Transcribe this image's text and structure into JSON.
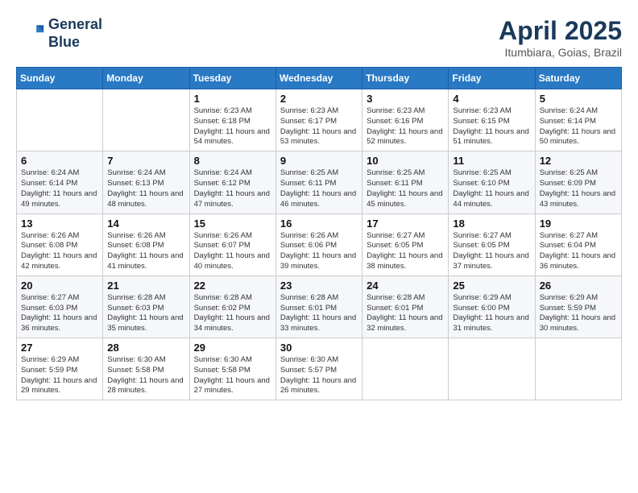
{
  "header": {
    "logo_line1": "General",
    "logo_line2": "Blue",
    "month": "April 2025",
    "location": "Itumbiara, Goias, Brazil"
  },
  "weekdays": [
    "Sunday",
    "Monday",
    "Tuesday",
    "Wednesday",
    "Thursday",
    "Friday",
    "Saturday"
  ],
  "weeks": [
    [
      {
        "day": "",
        "info": ""
      },
      {
        "day": "",
        "info": ""
      },
      {
        "day": "1",
        "info": "Sunrise: 6:23 AM\nSunset: 6:18 PM\nDaylight: 11 hours and 54 minutes."
      },
      {
        "day": "2",
        "info": "Sunrise: 6:23 AM\nSunset: 6:17 PM\nDaylight: 11 hours and 53 minutes."
      },
      {
        "day": "3",
        "info": "Sunrise: 6:23 AM\nSunset: 6:16 PM\nDaylight: 11 hours and 52 minutes."
      },
      {
        "day": "4",
        "info": "Sunrise: 6:23 AM\nSunset: 6:15 PM\nDaylight: 11 hours and 51 minutes."
      },
      {
        "day": "5",
        "info": "Sunrise: 6:24 AM\nSunset: 6:14 PM\nDaylight: 11 hours and 50 minutes."
      }
    ],
    [
      {
        "day": "6",
        "info": "Sunrise: 6:24 AM\nSunset: 6:14 PM\nDaylight: 11 hours and 49 minutes."
      },
      {
        "day": "7",
        "info": "Sunrise: 6:24 AM\nSunset: 6:13 PM\nDaylight: 11 hours and 48 minutes."
      },
      {
        "day": "8",
        "info": "Sunrise: 6:24 AM\nSunset: 6:12 PM\nDaylight: 11 hours and 47 minutes."
      },
      {
        "day": "9",
        "info": "Sunrise: 6:25 AM\nSunset: 6:11 PM\nDaylight: 11 hours and 46 minutes."
      },
      {
        "day": "10",
        "info": "Sunrise: 6:25 AM\nSunset: 6:11 PM\nDaylight: 11 hours and 45 minutes."
      },
      {
        "day": "11",
        "info": "Sunrise: 6:25 AM\nSunset: 6:10 PM\nDaylight: 11 hours and 44 minutes."
      },
      {
        "day": "12",
        "info": "Sunrise: 6:25 AM\nSunset: 6:09 PM\nDaylight: 11 hours and 43 minutes."
      }
    ],
    [
      {
        "day": "13",
        "info": "Sunrise: 6:26 AM\nSunset: 6:08 PM\nDaylight: 11 hours and 42 minutes."
      },
      {
        "day": "14",
        "info": "Sunrise: 6:26 AM\nSunset: 6:08 PM\nDaylight: 11 hours and 41 minutes."
      },
      {
        "day": "15",
        "info": "Sunrise: 6:26 AM\nSunset: 6:07 PM\nDaylight: 11 hours and 40 minutes."
      },
      {
        "day": "16",
        "info": "Sunrise: 6:26 AM\nSunset: 6:06 PM\nDaylight: 11 hours and 39 minutes."
      },
      {
        "day": "17",
        "info": "Sunrise: 6:27 AM\nSunset: 6:05 PM\nDaylight: 11 hours and 38 minutes."
      },
      {
        "day": "18",
        "info": "Sunrise: 6:27 AM\nSunset: 6:05 PM\nDaylight: 11 hours and 37 minutes."
      },
      {
        "day": "19",
        "info": "Sunrise: 6:27 AM\nSunset: 6:04 PM\nDaylight: 11 hours and 36 minutes."
      }
    ],
    [
      {
        "day": "20",
        "info": "Sunrise: 6:27 AM\nSunset: 6:03 PM\nDaylight: 11 hours and 36 minutes."
      },
      {
        "day": "21",
        "info": "Sunrise: 6:28 AM\nSunset: 6:03 PM\nDaylight: 11 hours and 35 minutes."
      },
      {
        "day": "22",
        "info": "Sunrise: 6:28 AM\nSunset: 6:02 PM\nDaylight: 11 hours and 34 minutes."
      },
      {
        "day": "23",
        "info": "Sunrise: 6:28 AM\nSunset: 6:01 PM\nDaylight: 11 hours and 33 minutes."
      },
      {
        "day": "24",
        "info": "Sunrise: 6:28 AM\nSunset: 6:01 PM\nDaylight: 11 hours and 32 minutes."
      },
      {
        "day": "25",
        "info": "Sunrise: 6:29 AM\nSunset: 6:00 PM\nDaylight: 11 hours and 31 minutes."
      },
      {
        "day": "26",
        "info": "Sunrise: 6:29 AM\nSunset: 5:59 PM\nDaylight: 11 hours and 30 minutes."
      }
    ],
    [
      {
        "day": "27",
        "info": "Sunrise: 6:29 AM\nSunset: 5:59 PM\nDaylight: 11 hours and 29 minutes."
      },
      {
        "day": "28",
        "info": "Sunrise: 6:30 AM\nSunset: 5:58 PM\nDaylight: 11 hours and 28 minutes."
      },
      {
        "day": "29",
        "info": "Sunrise: 6:30 AM\nSunset: 5:58 PM\nDaylight: 11 hours and 27 minutes."
      },
      {
        "day": "30",
        "info": "Sunrise: 6:30 AM\nSunset: 5:57 PM\nDaylight: 11 hours and 26 minutes."
      },
      {
        "day": "",
        "info": ""
      },
      {
        "day": "",
        "info": ""
      },
      {
        "day": "",
        "info": ""
      }
    ]
  ]
}
